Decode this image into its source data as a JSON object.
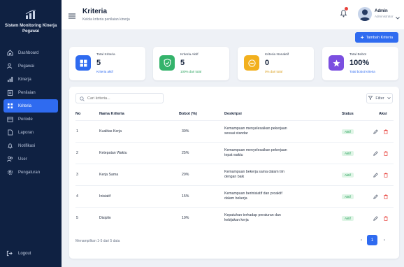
{
  "brand": {
    "title": "Sistem Monitoring Kinerja Pegawai"
  },
  "sidebar": {
    "items": [
      {
        "label": "Dashboard",
        "icon": "home-icon"
      },
      {
        "label": "Pegawai",
        "icon": "users-icon"
      },
      {
        "label": "Kinerja",
        "icon": "chart-icon"
      },
      {
        "label": "Penilaian",
        "icon": "clipboard-icon"
      },
      {
        "label": "Kriteria",
        "icon": "list-icon",
        "active": true
      },
      {
        "label": "Periode",
        "icon": "calendar-icon"
      },
      {
        "label": "Laporan",
        "icon": "report-icon"
      },
      {
        "label": "Notifikasi",
        "icon": "bell-icon"
      },
      {
        "label": "User",
        "icon": "user-group-icon"
      },
      {
        "label": "Pengaturan",
        "icon": "gear-icon"
      }
    ],
    "logout_label": "Logout"
  },
  "header": {
    "title": "Kriteria",
    "subtitle": "Kelola kriteria penilaian kinerja",
    "user_name": "Admin",
    "user_role": "Administrator"
  },
  "actions": {
    "add_label": "Tambah Kriteria"
  },
  "cards": [
    {
      "label": "Total Kriteria",
      "value": "5",
      "sub": "Kriteria aktif",
      "color": "#2f6bf0",
      "sub_color": "#2f6bf0",
      "icon": "grid-icon"
    },
    {
      "label": "Kriteria Aktif",
      "value": "5",
      "sub": "100% dari total",
      "color": "#34b36b",
      "sub_color": "#27a25c",
      "icon": "shield-check-icon"
    },
    {
      "label": "Kriteria Nonaktif",
      "value": "0",
      "sub": "0% dari total",
      "color": "#f2b01e",
      "sub_color": "#d89a10",
      "icon": "minus-circle-icon"
    },
    {
      "label": "Total Bobot",
      "value": "100%",
      "sub": "Total bobot kriteria",
      "color": "#7b4fe0",
      "sub_color": "#2f6bf0",
      "icon": "star-icon"
    }
  ],
  "search": {
    "placeholder": "Cari kriteria..."
  },
  "filter": {
    "label": "Filter"
  },
  "table": {
    "columns": {
      "no": "No",
      "name": "Nama Kriteria",
      "weight": "Bobot (%)",
      "desc": "Deskripsi",
      "status": "Status",
      "action": "Aksi"
    },
    "rows": [
      {
        "no": "1",
        "name": "Kualitas Kerja",
        "weight": "30%",
        "desc": "Kemampuan menyelesaikan pekerjaan sesuai standar",
        "status": "Aktif"
      },
      {
        "no": "2",
        "name": "Ketepatan Waktu",
        "weight": "25%",
        "desc": "Kemampuan menyelesaikan pekerjaan tepat waktu",
        "status": "Aktif"
      },
      {
        "no": "3",
        "name": "Kerja Sama",
        "weight": "20%",
        "desc": "Kemampuan bekerja sama dalam tim dengan baik",
        "status": "Aktif"
      },
      {
        "no": "4",
        "name": "Inisiatif",
        "weight": "15%",
        "desc": "Kemampuan berinisiatif dan proaktif dalam bekerja",
        "status": "Aktif"
      },
      {
        "no": "5",
        "name": "Disiplin",
        "weight": "10%",
        "desc": "Kepatuhan terhadap peraturan dan kebijakan kerja",
        "status": "Aktif"
      }
    ]
  },
  "footer": {
    "summary": "Menampilkan 1-5 dari 5 data",
    "prev": "‹",
    "page": "1",
    "next": "›"
  }
}
